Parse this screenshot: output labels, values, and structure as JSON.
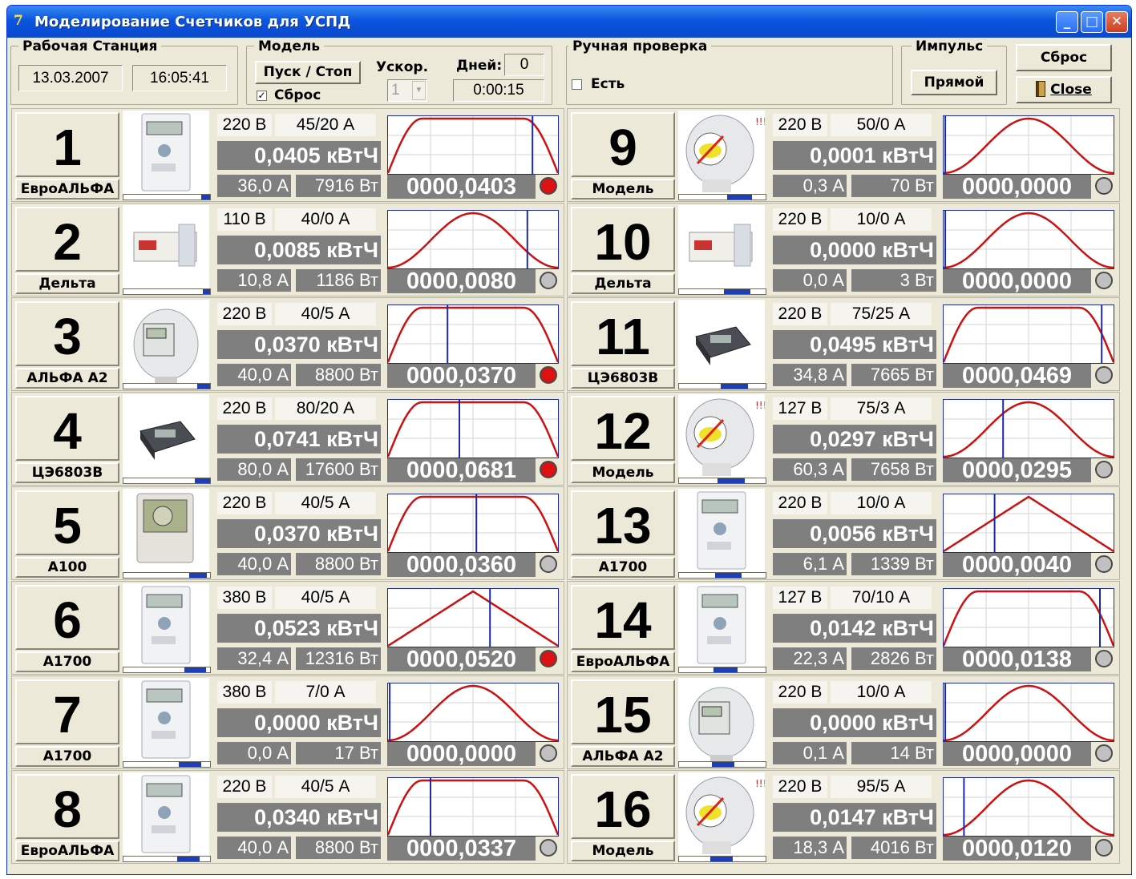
{
  "window": {
    "title": "Моделирование Счетчиков для УСПД",
    "minimize": "_",
    "maximize": "□",
    "close": "✕"
  },
  "workstation": {
    "label": "Рабочая Станция",
    "date": "13.03.2007",
    "time": "16:05:41"
  },
  "model": {
    "label": "Модель",
    "start_stop": "Пуск / Стоп",
    "reset_label": "Сброс",
    "reset_checked": true,
    "accel_label": "Ускор.",
    "accel_value": "1",
    "days_label": "Дней:",
    "days_value": "0",
    "elapsed": "0:00:15"
  },
  "manual": {
    "label": "Ручная проверка",
    "has_label": "Есть",
    "has_checked": false
  },
  "impulse": {
    "label": "Импульс",
    "mode_button": "Прямой"
  },
  "actions": {
    "reset_button": "Сброс",
    "close_button": "Close"
  },
  "colors": {
    "curve": "#cc1111",
    "cursor": "#1a2aa8",
    "lamp_active": "#dd1111",
    "lamp_idle": "#c0c0c0",
    "value_bg": "#7f7f7f",
    "progress": "#1e3eb5"
  },
  "meters": [
    {
      "num": "1",
      "model": "ЕвроАЛЬФА",
      "icon": "meter-euroalpha-icon",
      "voltage": "220 В",
      "current_rating": "45/20 А",
      "energy": "0,0405 кВтЧ",
      "current": "36,0 А",
      "power": "7916 Вт",
      "counter": "0000,0403",
      "lamp": "red",
      "wave": "trapezoid",
      "cursor": 0.85,
      "progress": [
        0.9,
        1.0
      ]
    },
    {
      "num": "2",
      "model": "Дельта",
      "icon": "meter-delta-icon",
      "voltage": "110 В",
      "current_rating": "40/0 А",
      "energy": "0,0085 кВтЧ",
      "current": "10,8 А",
      "power": "1186 Вт",
      "counter": "0000,0080",
      "lamp": "grey",
      "wave": "bell",
      "cursor": 0.82,
      "progress": [
        0.92,
        1.0
      ]
    },
    {
      "num": "3",
      "model": "АЛЬФА А2",
      "icon": "meter-alpha-a2-icon",
      "voltage": "220 В",
      "current_rating": "40/5 А",
      "energy": "0,0370 кВтЧ",
      "current": "40,0 А",
      "power": "8800 Вт",
      "counter": "0000,0370",
      "lamp": "red",
      "wave": "trapezoid",
      "cursor": 0.35,
      "progress": [
        0.85,
        1.0
      ]
    },
    {
      "num": "4",
      "model": "ЦЭ6803В",
      "icon": "meter-ce6803v-icon",
      "voltage": "220 В",
      "current_rating": "80/20 А",
      "energy": "0,0741 кВтЧ",
      "current": "80,0 А",
      "power": "17600 Вт",
      "counter": "0000,0681",
      "lamp": "red",
      "wave": "trapezoid",
      "cursor": 0.42,
      "progress": [
        0.82,
        1.0
      ]
    },
    {
      "num": "5",
      "model": "А100",
      "icon": "meter-a100-icon",
      "voltage": "220 В",
      "current_rating": "40/5 А",
      "energy": "0,0370 кВтЧ",
      "current": "40,0 А",
      "power": "8800 Вт",
      "counter": "0000,0360",
      "lamp": "grey",
      "wave": "trapezoid",
      "cursor": 0.52,
      "progress": [
        0.76,
        0.96
      ]
    },
    {
      "num": "6",
      "model": "А1700",
      "icon": "meter-a1700-icon",
      "voltage": "380 В",
      "current_rating": "40/5 А",
      "energy": "0,0523 кВтЧ",
      "current": "32,4 А",
      "power": "12316 Вт",
      "counter": "0000,0520",
      "lamp": "red",
      "wave": "triangle",
      "cursor": 0.6,
      "progress": [
        0.7,
        0.95
      ]
    },
    {
      "num": "7",
      "model": "А1700",
      "icon": "meter-a1700-icon",
      "voltage": "380 В",
      "current_rating": "7/0 А",
      "energy": "0,0000 кВтЧ",
      "current": "0,0 А",
      "power": "17 Вт",
      "counter": "0000,0000",
      "lamp": "grey",
      "wave": "bell",
      "cursor": 0.01,
      "progress": [
        0.64,
        0.9
      ]
    },
    {
      "num": "8",
      "model": "ЕвроАЛЬФА",
      "icon": "meter-euroalpha-icon",
      "voltage": "220 В",
      "current_rating": "40/5 А",
      "energy": "0,0340 кВтЧ",
      "current": "40,0 А",
      "power": "8800 Вт",
      "counter": "0000,0337",
      "lamp": "grey",
      "wave": "trapezoid",
      "cursor": 0.25,
      "progress": [
        0.62,
        0.88
      ]
    },
    {
      "num": "9",
      "model": "Модель",
      "icon": "meter-model-icon",
      "voltage": "220 В",
      "current_rating": "50/0 А",
      "energy": "0,0001 кВтЧ",
      "current": "0,3 А",
      "power": "70 Вт",
      "counter": "0000,0000",
      "lamp": "grey",
      "wave": "bell",
      "cursor": 0.01,
      "progress": [
        0.56,
        0.84
      ]
    },
    {
      "num": "10",
      "model": "Дельта",
      "icon": "meter-delta-icon",
      "voltage": "220 В",
      "current_rating": "10/0 А",
      "energy": "0,0000 кВтЧ",
      "current": "0,0 А",
      "power": "3 Вт",
      "counter": "0000,0000",
      "lamp": "grey",
      "wave": "bell",
      "cursor": 0.01,
      "progress": [
        0.52,
        0.82
      ]
    },
    {
      "num": "11",
      "model": "ЦЭ6803В",
      "icon": "meter-ce6803v-icon",
      "voltage": "220 В",
      "current_rating": "75/25 А",
      "energy": "0,0495 кВтЧ",
      "current": "34,8 А",
      "power": "7665 Вт",
      "counter": "0000,0469",
      "lamp": "grey",
      "wave": "trapezoid",
      "cursor": 0.93,
      "progress": [
        0.48,
        0.8
      ]
    },
    {
      "num": "12",
      "model": "Модель",
      "icon": "meter-model-icon",
      "voltage": "127 В",
      "current_rating": "75/3 А",
      "energy": "0,0297 кВтЧ",
      "current": "60,3 А",
      "power": "7658 Вт",
      "counter": "0000,0295",
      "lamp": "grey",
      "wave": "bell",
      "cursor": 0.35,
      "progress": [
        0.44,
        0.76
      ]
    },
    {
      "num": "13",
      "model": "А1700",
      "icon": "meter-a1700-icon",
      "voltage": "220 В",
      "current_rating": "10/0 А",
      "energy": "0,0056 кВтЧ",
      "current": "6,1 А",
      "power": "1339 Вт",
      "counter": "0000,0040",
      "lamp": "grey",
      "wave": "triangle",
      "cursor": 0.3,
      "progress": [
        0.42,
        0.72
      ]
    },
    {
      "num": "14",
      "model": "ЕвроАЛЬФА",
      "icon": "meter-euroalpha-icon",
      "voltage": "127 В",
      "current_rating": "70/10 А",
      "energy": "0,0142 кВтЧ",
      "current": "22,3 А",
      "power": "2826 Вт",
      "counter": "0000,0138",
      "lamp": "grey",
      "wave": "trapezoid",
      "cursor": 0.92,
      "progress": [
        0.4,
        0.68
      ]
    },
    {
      "num": "15",
      "model": "АЛЬФА А2",
      "icon": "meter-alpha-a2-icon",
      "voltage": "220 В",
      "current_rating": "10/0 А",
      "energy": "0,0000 кВтЧ",
      "current": "0,1 А",
      "power": "14 Вт",
      "counter": "0000,0000",
      "lamp": "grey",
      "wave": "bell",
      "cursor": 0.01,
      "progress": [
        0.38,
        0.64
      ]
    },
    {
      "num": "16",
      "model": "Модель",
      "icon": "meter-model-icon",
      "voltage": "220 В",
      "current_rating": "95/5 А",
      "energy": "0,0147 кВтЧ",
      "current": "18,3 А",
      "power": "4016 Вт",
      "counter": "0000,0120",
      "lamp": "grey",
      "wave": "bell",
      "cursor": 0.12,
      "progress": [
        0.36,
        0.62
      ]
    }
  ]
}
